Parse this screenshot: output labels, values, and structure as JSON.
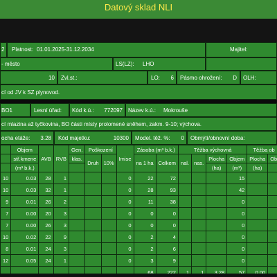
{
  "title": "Datový sklad NLI",
  "row1": {
    "left_fragment": "2",
    "platnost_label": "Platnost:",
    "platnost_value": "01.01.2025-31.12.2034",
    "majitel_label": "Majitel:"
  },
  "row2": {
    "mesto": "- město",
    "ls_label": "LS(LZ):",
    "ls_value": "LHO"
  },
  "row3": {
    "num": "10",
    "zvl_label": "Zvl.st.:",
    "lo_label": "LO:",
    "lo_value": "6",
    "pasmo_label": "Pásmo ohrožení:",
    "pasmo_value": "D",
    "olh_label": "OLH:"
  },
  "row4": {
    "text": "cí od JV k SZ plynovod."
  },
  "row5": {
    "left_fragment": "BO1",
    "lesni_label": "Lesní úřad:",
    "kod_label": "Kód k.ú.:",
    "kod_value": "772097",
    "nazev_label": "Název k.ú.:",
    "nazev_value": "Mokrouše"
  },
  "row6": {
    "text": "cí mlazina až tyčkovina, BO části místy prolomené sněhem, zakm. 9-10; výchova."
  },
  "row7": {
    "plocha_label": "ocha etáže:",
    "plocha_value": "3.28",
    "kod_maj_label": "Kód majetku:",
    "kod_maj_value": "10300",
    "model_label": "Model. těž. %:",
    "model_value": "0",
    "obmyti_label": "Obmýtí/obnovní doba:"
  },
  "table": {
    "headers": {
      "objem": "Objem",
      "stf": "stř.kmene",
      "m3": "(m³ b.k.)",
      "avb": "AVB",
      "rvb": "RVB",
      "gen": "Gen.",
      "klas": "klas.",
      "poskozeni": "Poškození",
      "druh": "Druh",
      "pct": "10%",
      "imise": "Imise",
      "zasoba": "Zásoba (m³ b.k.)",
      "na1ha": "na 1 ha",
      "celkem": "Celkem",
      "tezba_vych": "Těžba výchovná",
      "nal": "nal.",
      "nas": "nas.",
      "plocha": "Plocha",
      "ha": "(ha)",
      "objem2": "Objem",
      "m3b": "(m³)",
      "tezba_obn": "Těžba ob",
      "plocha2": "Plocha",
      "ha2": "(ha)",
      "objem3": "Obj"
    },
    "rows": [
      {
        "a": "10",
        "b": "0.03",
        "c": "28",
        "d": "1",
        "imise": "0",
        "na1ha": "22",
        "celkem": "72",
        "objem": "15"
      },
      {
        "a": "10",
        "b": "0.03",
        "c": "32",
        "d": "1",
        "imise": "0",
        "na1ha": "28",
        "celkem": "93",
        "objem": "42"
      },
      {
        "a": "9",
        "b": "0.01",
        "c": "26",
        "d": "2",
        "imise": "0",
        "na1ha": "11",
        "celkem": "38",
        "objem": "0"
      },
      {
        "a": "7",
        "b": "0.00",
        "c": "20",
        "d": "3",
        "imise": "0",
        "na1ha": "0",
        "celkem": "0",
        "objem": "0"
      },
      {
        "a": "7",
        "b": "0.00",
        "c": "26",
        "d": "3",
        "imise": "0",
        "na1ha": "0",
        "celkem": "0",
        "objem": "0"
      },
      {
        "a": "10",
        "b": "0.02",
        "c": "22",
        "d": "9",
        "imise": "0",
        "na1ha": "2",
        "celkem": "4",
        "objem": "0"
      },
      {
        "a": "8",
        "b": "0.01",
        "c": "24",
        "d": "3",
        "imise": "0",
        "na1ha": "2",
        "celkem": "6",
        "objem": "0"
      },
      {
        "a": "12",
        "b": "0.05",
        "c": "24",
        "d": "1",
        "imise": "0",
        "na1ha": "3",
        "celkem": "9",
        "objem": "0"
      }
    ],
    "total": {
      "na1ha": "68",
      "celkem": "222",
      "nal": "1",
      "nas": "1",
      "plocha": "3.28",
      "objem": "57",
      "plocha2": "0.00"
    }
  }
}
